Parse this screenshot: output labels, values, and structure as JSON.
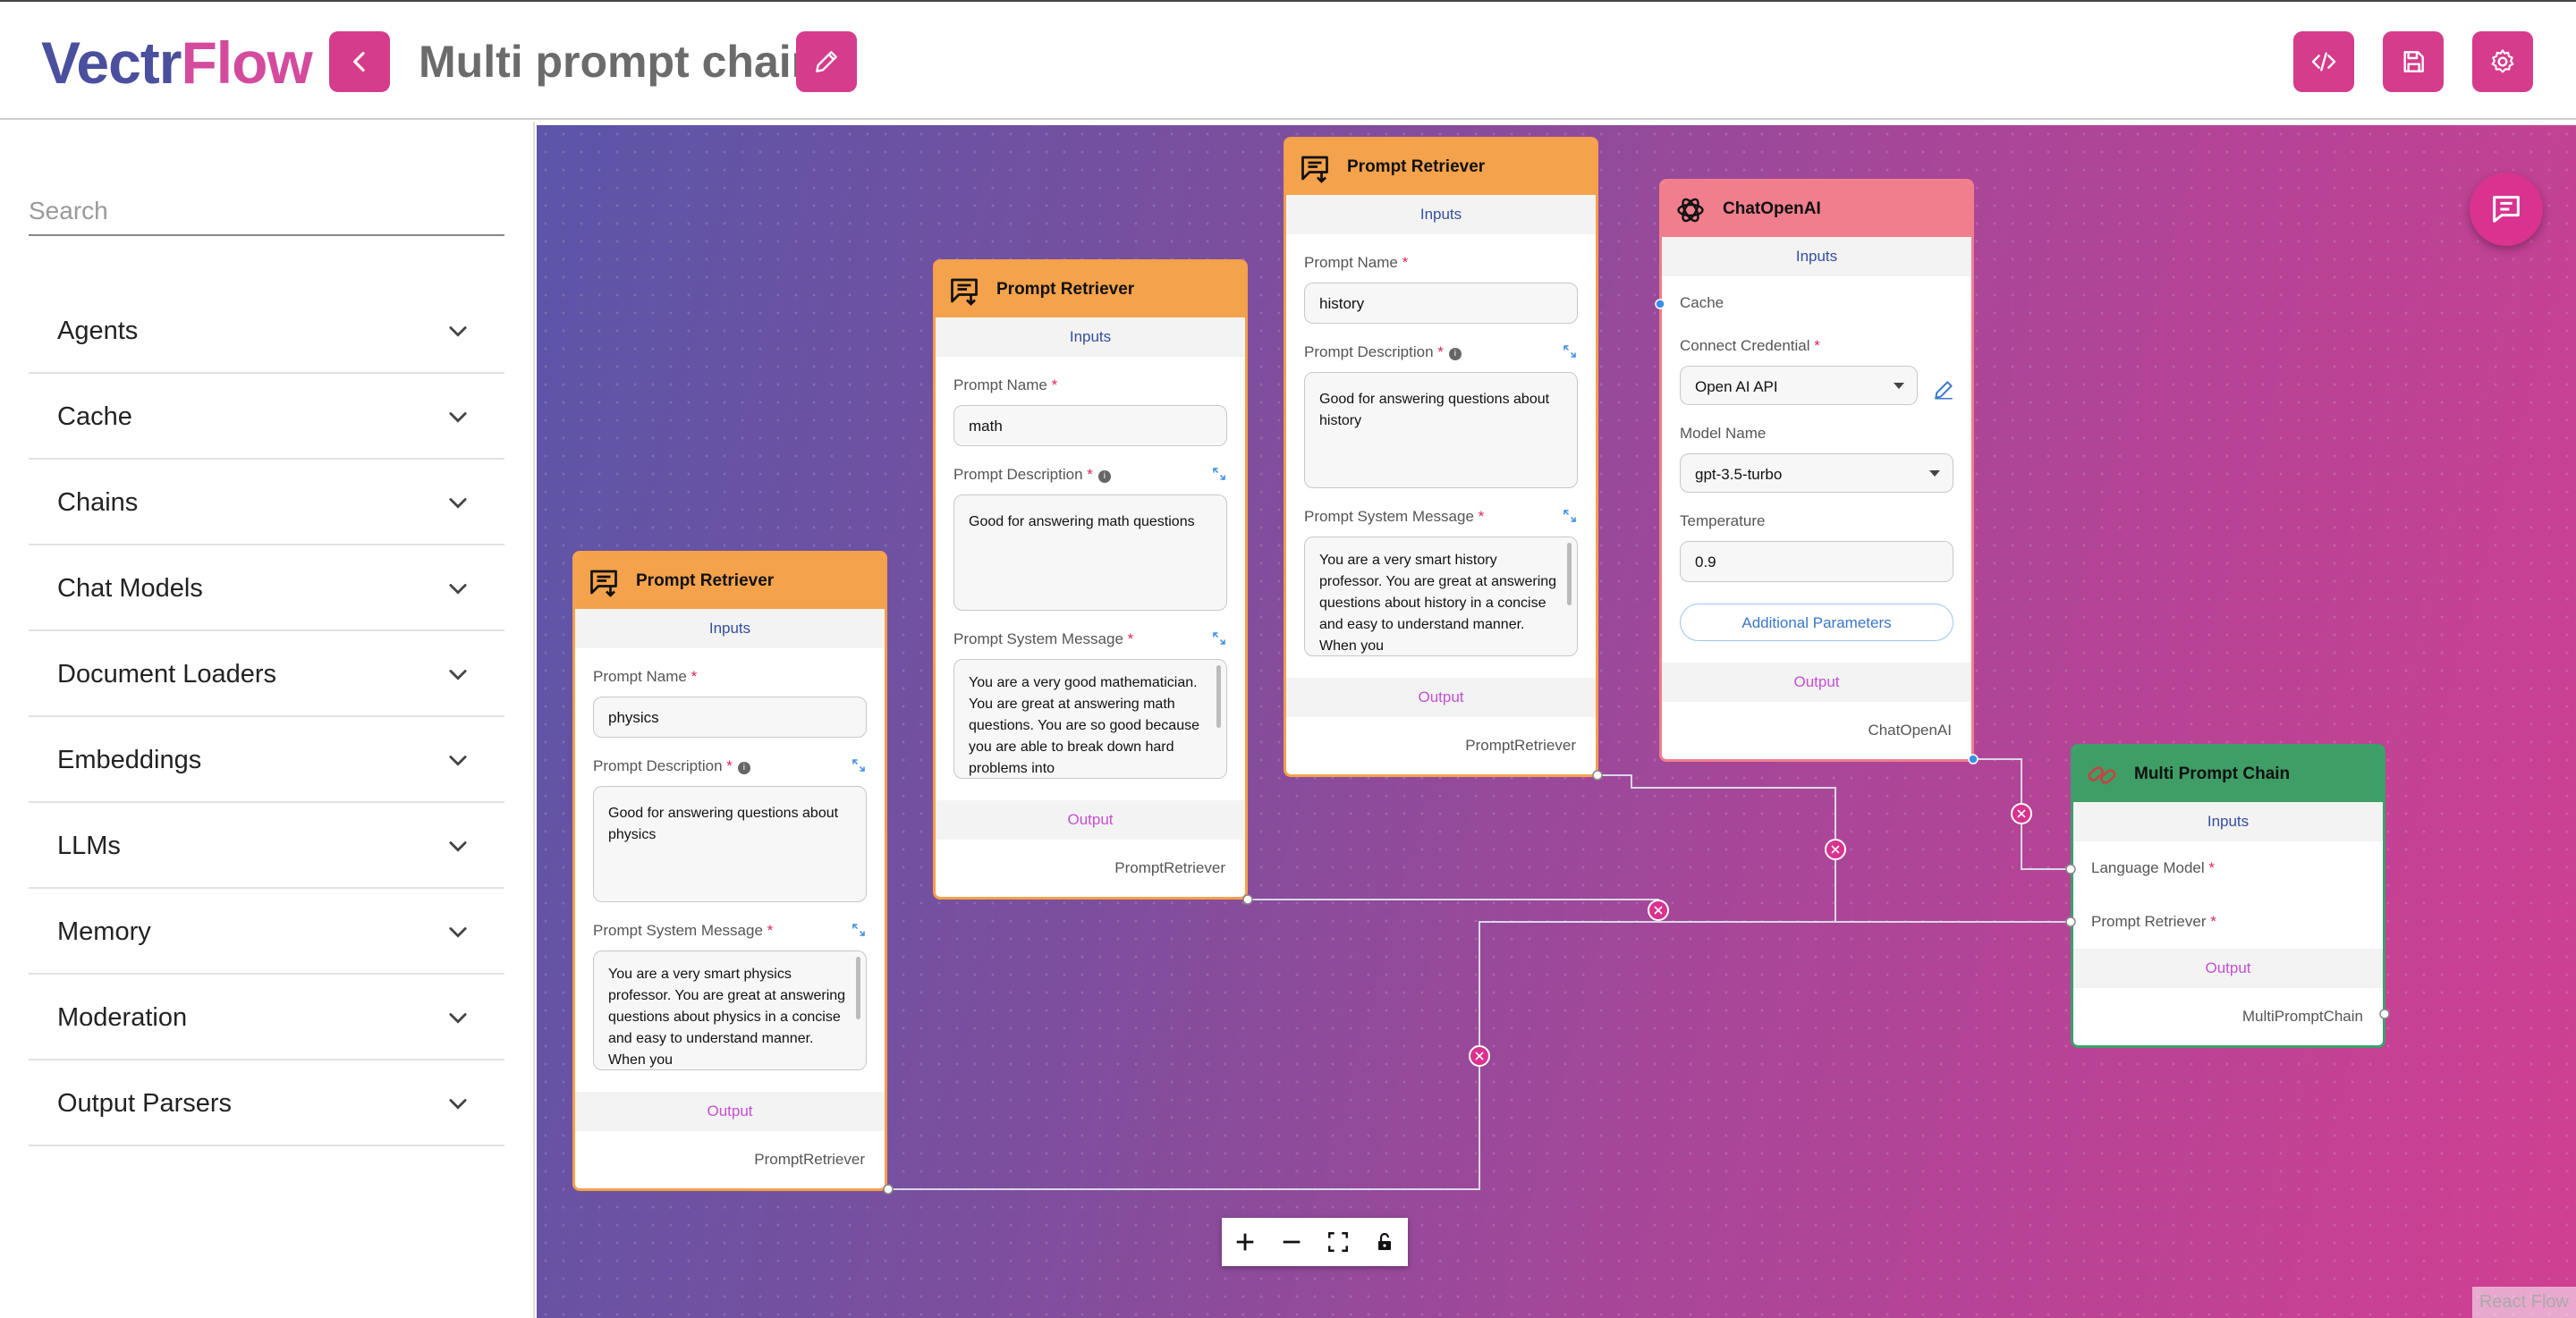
{
  "header": {
    "logo_part1": "Vectr",
    "logo_part2": "Flow",
    "flow_title": "Multi prompt chain"
  },
  "sidebar": {
    "search_placeholder": "Search",
    "categories": [
      {
        "label": "Agents"
      },
      {
        "label": "Cache"
      },
      {
        "label": "Chains"
      },
      {
        "label": "Chat Models"
      },
      {
        "label": "Document Loaders"
      },
      {
        "label": "Embeddings"
      },
      {
        "label": "LLMs"
      },
      {
        "label": "Memory"
      },
      {
        "label": "Moderation"
      },
      {
        "label": "Output Parsers"
      }
    ]
  },
  "nodes": {
    "physics": {
      "title": "Prompt Retriever",
      "inputs_label": "Inputs",
      "name_label": "Prompt Name",
      "name_value": "physics",
      "desc_label": "Prompt Description",
      "desc_value": "Good for answering questions about physics",
      "sys_label": "Prompt System Message",
      "sys_value": "You are a very smart physics professor. You are great at answering questions about physics in a concise and easy to understand manner. When you",
      "output_label": "Output",
      "output_anchor": "PromptRetriever"
    },
    "math": {
      "title": "Prompt Retriever",
      "inputs_label": "Inputs",
      "name_label": "Prompt Name",
      "name_value": "math",
      "desc_label": "Prompt Description",
      "desc_value": "Good for answering math questions",
      "sys_label": "Prompt System Message",
      "sys_value": "You are a very good mathematician. You are great at answering math questions. You are so good because you are able to break down hard problems into",
      "output_label": "Output",
      "output_anchor": "PromptRetriever"
    },
    "history": {
      "title": "Prompt Retriever",
      "inputs_label": "Inputs",
      "name_label": "Prompt Name",
      "name_value": "history",
      "desc_label": "Prompt Description",
      "desc_value": "Good for answering questions about history",
      "sys_label": "Prompt System Message",
      "sys_value": "You are a very smart history professor. You are great at answering questions about history in a concise and easy to understand manner. When you",
      "output_label": "Output",
      "output_anchor": "PromptRetriever"
    },
    "chatopenai": {
      "title": "ChatOpenAI",
      "inputs_label": "Inputs",
      "cache_label": "Cache",
      "credential_label": "Connect Credential",
      "credential_value": "Open AI API",
      "model_label": "Model Name",
      "model_value": "gpt-3.5-turbo",
      "temp_label": "Temperature",
      "temp_value": "0.9",
      "additional_label": "Additional Parameters",
      "output_label": "Output",
      "output_anchor": "ChatOpenAI"
    },
    "multiprompt": {
      "title": "Multi Prompt Chain",
      "inputs_label": "Inputs",
      "lm_label": "Language Model",
      "pr_label": "Prompt Retriever",
      "output_label": "Output",
      "output_anchor": "MultiPromptChain"
    }
  },
  "canvas": {
    "watermark": "React Flow"
  },
  "colors": {
    "accent": "#d63c8c",
    "node_orange": "#f4a24b",
    "node_salmon": "#f07e8c",
    "node_green": "#3e9e66"
  }
}
